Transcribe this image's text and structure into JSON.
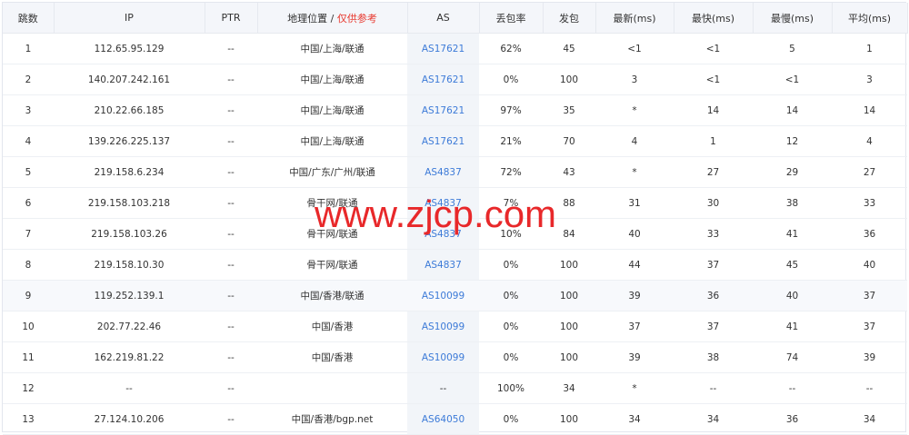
{
  "columns": {
    "hop": "跳数",
    "ip": "IP",
    "ptr": "PTR",
    "location": "地理位置",
    "location_sep": " / ",
    "location_note": "仅供参考",
    "as": "AS",
    "loss": "丢包率",
    "sent": "发包",
    "latest": "最新(ms)",
    "best": "最快(ms)",
    "worst": "最慢(ms)",
    "avg": "平均(ms)"
  },
  "rows": [
    {
      "hop": "1",
      "ip": "112.65.95.129",
      "ptr": "--",
      "location": "中国/上海/联通",
      "as": "AS17621",
      "loss": "62%",
      "sent": "45",
      "latest": "<1",
      "best": "<1",
      "worst": "5",
      "avg": "1"
    },
    {
      "hop": "2",
      "ip": "140.207.242.161",
      "ptr": "--",
      "location": "中国/上海/联通",
      "as": "AS17621",
      "loss": "0%",
      "sent": "100",
      "latest": "3",
      "best": "<1",
      "worst": "<1",
      "avg": "3"
    },
    {
      "hop": "3",
      "ip": "210.22.66.185",
      "ptr": "--",
      "location": "中国/上海/联通",
      "as": "AS17621",
      "loss": "97%",
      "sent": "35",
      "latest": "*",
      "best": "14",
      "worst": "14",
      "avg": "14"
    },
    {
      "hop": "4",
      "ip": "139.226.225.137",
      "ptr": "--",
      "location": "中国/上海/联通",
      "as": "AS17621",
      "loss": "21%",
      "sent": "70",
      "latest": "4",
      "best": "1",
      "worst": "12",
      "avg": "4"
    },
    {
      "hop": "5",
      "ip": "219.158.6.234",
      "ptr": "--",
      "location": "中国/广东/广州/联通",
      "as": "AS4837",
      "loss": "72%",
      "sent": "43",
      "latest": "*",
      "best": "27",
      "worst": "29",
      "avg": "27"
    },
    {
      "hop": "6",
      "ip": "219.158.103.218",
      "ptr": "--",
      "location": "骨干网/联通",
      "as": "AS4837",
      "loss": "7%",
      "sent": "88",
      "latest": "31",
      "best": "30",
      "worst": "38",
      "avg": "33"
    },
    {
      "hop": "7",
      "ip": "219.158.103.26",
      "ptr": "--",
      "location": "骨干网/联通",
      "as": "AS4837",
      "loss": "10%",
      "sent": "84",
      "latest": "40",
      "best": "33",
      "worst": "41",
      "avg": "36"
    },
    {
      "hop": "8",
      "ip": "219.158.10.30",
      "ptr": "--",
      "location": "骨干网/联通",
      "as": "AS4837",
      "loss": "0%",
      "sent": "100",
      "latest": "44",
      "best": "37",
      "worst": "45",
      "avg": "40"
    },
    {
      "hop": "9",
      "ip": "119.252.139.1",
      "ptr": "--",
      "location": "中国/香港/联通",
      "as": "AS10099",
      "loss": "0%",
      "sent": "100",
      "latest": "39",
      "best": "36",
      "worst": "40",
      "avg": "37"
    },
    {
      "hop": "10",
      "ip": "202.77.22.46",
      "ptr": "--",
      "location": "中国/香港",
      "as": "AS10099",
      "loss": "0%",
      "sent": "100",
      "latest": "37",
      "best": "37",
      "worst": "41",
      "avg": "37"
    },
    {
      "hop": "11",
      "ip": "162.219.81.22",
      "ptr": "--",
      "location": "中国/香港",
      "as": "AS10099",
      "loss": "0%",
      "sent": "100",
      "latest": "39",
      "best": "38",
      "worst": "74",
      "avg": "39"
    },
    {
      "hop": "12",
      "ip": "--",
      "ptr": "--",
      "location": "",
      "as": "--",
      "loss": "100%",
      "sent": "34",
      "latest": "*",
      "best": "--",
      "worst": "--",
      "avg": "--"
    },
    {
      "hop": "13",
      "ip": "27.124.10.206",
      "ptr": "--",
      "location": "中国/香港/bgp.net",
      "as": "AS64050",
      "loss": "0%",
      "sent": "100",
      "latest": "34",
      "best": "34",
      "worst": "36",
      "avg": "34"
    }
  ],
  "highlight_row": 8,
  "watermark": "www.zjcp.com",
  "colors": {
    "as_link": "#3d7bd8",
    "note": "#e8382e",
    "watermark": "#e8282a",
    "header_bg": "#f4f6fa"
  }
}
